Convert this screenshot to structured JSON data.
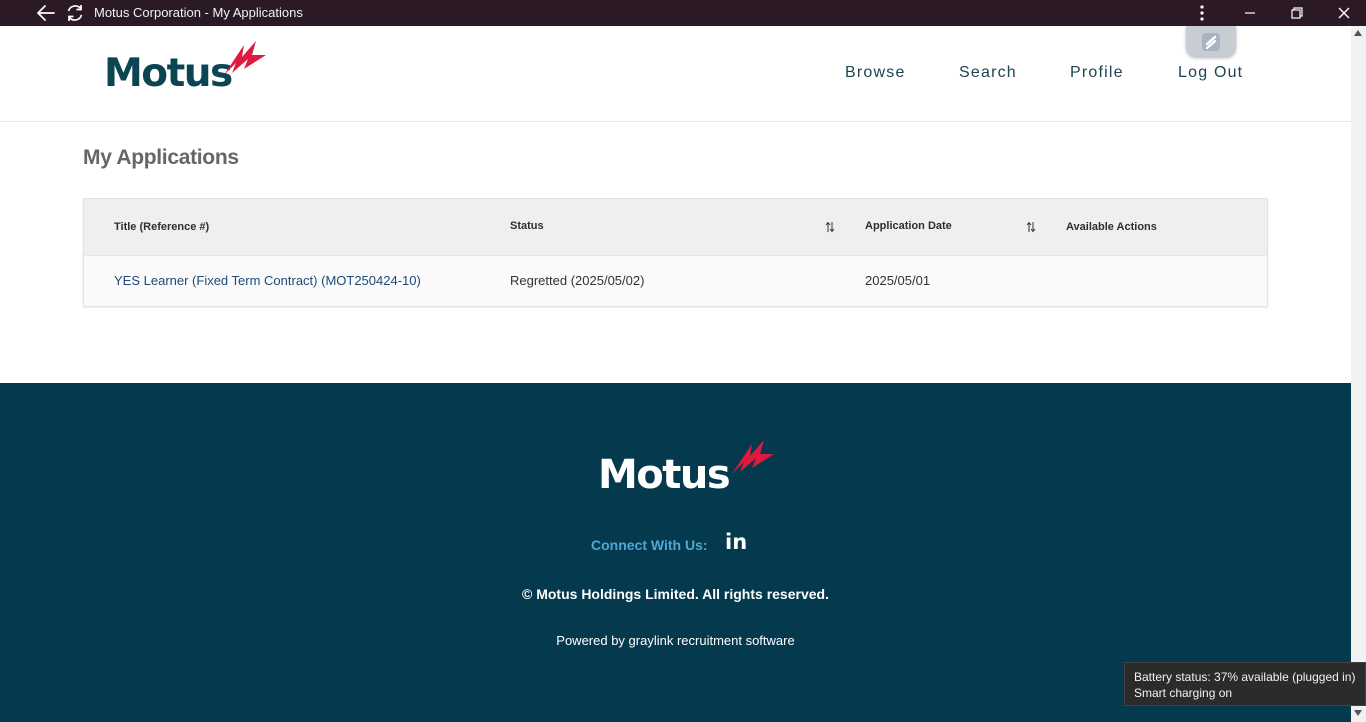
{
  "browser": {
    "window_title": "Motus Corporation - My Applications"
  },
  "header": {
    "logo_text": "Motus",
    "nav": {
      "browse": "Browse",
      "search": "Search",
      "profile": "Profile",
      "logout": "Log Out"
    }
  },
  "main": {
    "page_title": "My Applications",
    "table": {
      "columns": {
        "title": "Title (Reference #)",
        "status": "Status",
        "date": "Application Date",
        "actions": "Available Actions"
      },
      "rows": [
        {
          "title": "YES Learner (Fixed Term Contract) (MOT250424-10)",
          "status": "Regretted (2025/05/02)",
          "date": "2025/05/01",
          "actions": ""
        }
      ]
    }
  },
  "footer": {
    "logo_text": "Motus",
    "connect_label": "Connect With Us:",
    "social": "in",
    "copyright": "© Motus Holdings Limited. All rights reserved.",
    "powered_by": "Powered by graylink recruitment software"
  },
  "system": {
    "tooltip_line1": "Battery status: 37% available (plugged in)",
    "tooltip_line2": "Smart charging on"
  },
  "colors": {
    "titlebar": "#2b1a26",
    "brand_teal": "#0c4552",
    "brand_red": "#e0193e",
    "footer_bg": "#053a4e",
    "link_blue": "#1f4a78",
    "connect_blue": "#4fa7d6"
  },
  "icons": [
    "back-arrow-icon",
    "refresh-icon",
    "more-options-icon",
    "minimize-icon",
    "maximize-icon",
    "close-icon",
    "extension-icon",
    "sort-icon",
    "linkedin-icon",
    "bolt-logo-icon"
  ]
}
